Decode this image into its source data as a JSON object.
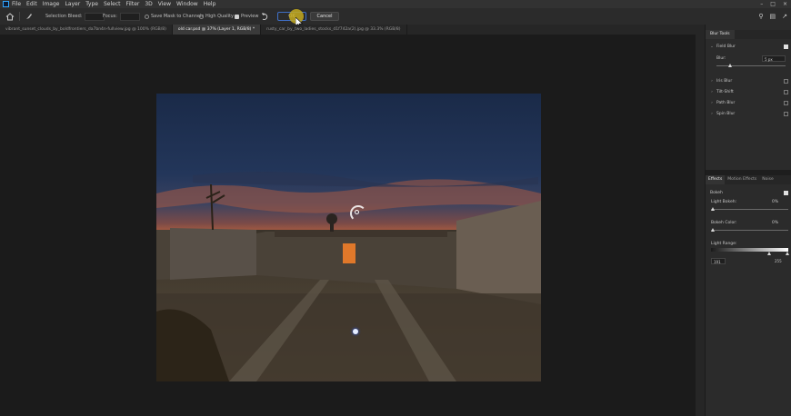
{
  "menubar": {
    "items": [
      "File",
      "Edit",
      "Image",
      "Layer",
      "Type",
      "Select",
      "Filter",
      "3D",
      "View",
      "Window",
      "Help"
    ]
  },
  "options": {
    "selection_bleed_label": "Selection Bleed:",
    "focus_label": "Focus:",
    "save_mask_label": "Save Mask to Channels",
    "high_quality_label": "High Quality",
    "preview_label": "Preview",
    "ok_label": "OK",
    "cancel_label": "Cancel"
  },
  "tabs": [
    {
      "label": "vibrant_sunset_clouds_by_boldfrontiers_da7bn4n-fullview.jpg @ 100% (RGB/8)",
      "active": false
    },
    {
      "label": "old car.psd @ 37% (Layer 1, RGB/8) *",
      "active": true
    },
    {
      "label": "rusty_car_by_two_ladies_stocks_d1f742a(2).jpg @ 33.3% (RGB/8)",
      "active": false
    }
  ],
  "panel": {
    "title": "Blur Tools",
    "field_blur_label": "Field Blur",
    "blur_label": "Blur:",
    "blur_value": "5 px",
    "iris_blur_label": "Iris Blur",
    "tilt_shift_label": "Tilt-Shift",
    "path_blur_label": "Path Blur",
    "spin_blur_label": "Spin Blur",
    "effects_tabs": [
      "Effects",
      "Motion Effects",
      "Noise"
    ],
    "bokeh_label": "Bokeh",
    "light_bokeh_label": "Light Bokeh:",
    "light_bokeh_value": "0%",
    "bokeh_color_label": "Bokeh Color:",
    "bokeh_color_value": "0%",
    "light_range_label": "Light Range:",
    "light_range_min": "191",
    "light_range_max": "255"
  }
}
